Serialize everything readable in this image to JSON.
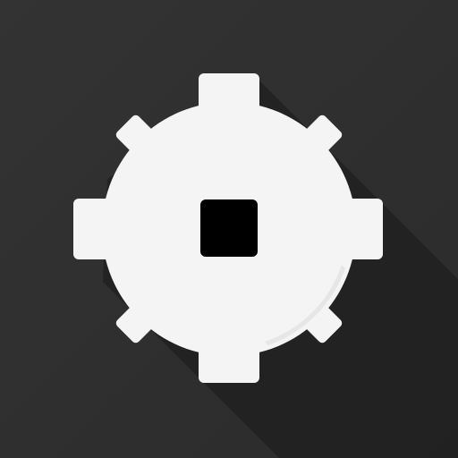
{
  "icon": {
    "name": "mine-gear-icon",
    "description": "",
    "colors": {
      "background": "#2b2b2b",
      "background_top": "#333333",
      "gear": "#f4f4f4",
      "gear_shade": "#e2e2e2",
      "hole": "#000000",
      "long_shadow": "#1f1f1f"
    }
  }
}
